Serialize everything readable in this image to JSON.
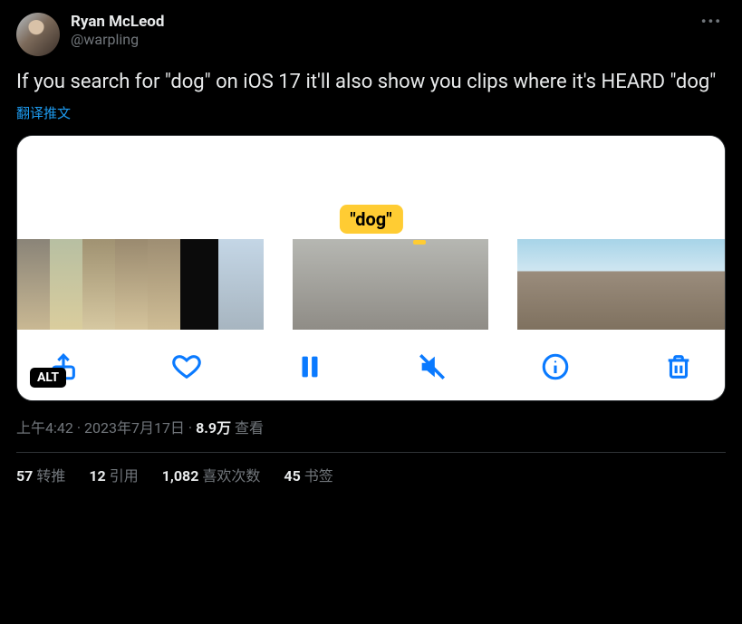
{
  "author": {
    "name": "Ryan McLeod",
    "handle": "@warpling"
  },
  "menu_label": "•••",
  "body": "If you search for \"dog\" on iOS 17 it'll also show you clips where it's HEARD \"dog\"",
  "translate_label": "翻译推文",
  "media": {
    "caption_pill": "\"dog\"",
    "alt_badge": "ALT",
    "toolbar": {
      "share": "share-icon",
      "like": "heart-icon",
      "pause": "pause-icon",
      "mute": "mute-icon",
      "info": "info-icon",
      "trash": "trash-icon"
    }
  },
  "meta": {
    "time": "上午4:42",
    "date": "2023年7月17日",
    "sep": " · ",
    "views_count": "8.9万",
    "views_label": " 查看"
  },
  "stats": {
    "retweets_n": "57",
    "retweets_l": "转推",
    "quotes_n": "12",
    "quotes_l": "引用",
    "likes_n": "1,082",
    "likes_l": "喜欢次数",
    "bookmarks_n": "45",
    "bookmarks_l": "书签"
  }
}
